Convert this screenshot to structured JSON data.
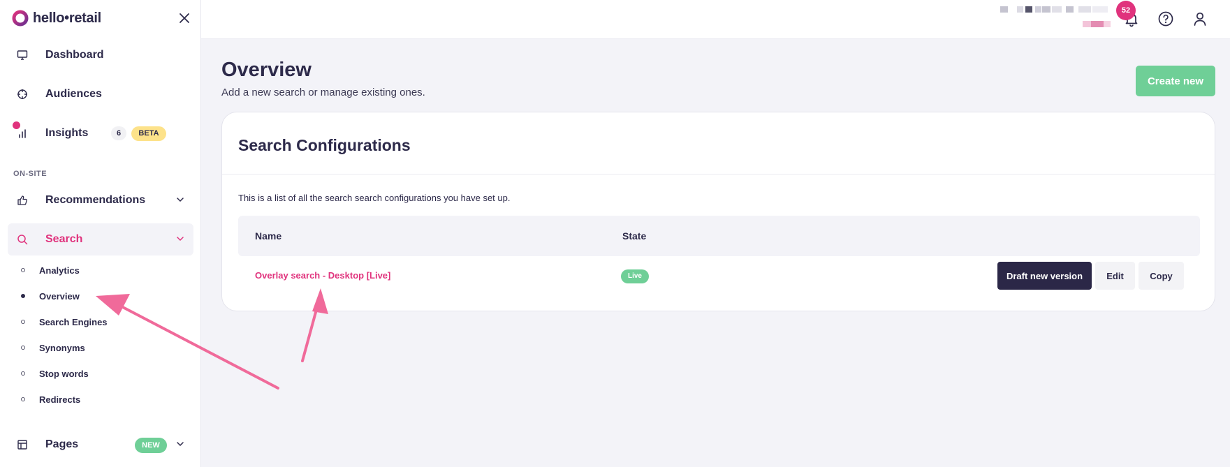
{
  "brand": {
    "name": "hello•retail",
    "pink": "#e0337d",
    "navy": "#2d2a4a",
    "green": "#6fcf97",
    "yellow": "#fde28a"
  },
  "sidebar": {
    "items": [
      {
        "label": "Dashboard",
        "icon": "monitor-icon"
      },
      {
        "label": "Audiences",
        "icon": "crosshair-icon"
      },
      {
        "label": "Insights",
        "icon": "bar-chart-icon",
        "count": "6",
        "badge": "BETA"
      }
    ],
    "section_label": "ON-SITE",
    "recommendations": {
      "label": "Recommendations",
      "icon": "thumbs-up-icon"
    },
    "search": {
      "label": "Search",
      "icon": "search-icon",
      "sub_items": [
        {
          "label": "Analytics",
          "active": false
        },
        {
          "label": "Overview",
          "active": true
        },
        {
          "label": "Search Engines",
          "active": false
        },
        {
          "label": "Synonyms",
          "active": false
        },
        {
          "label": "Stop words",
          "active": false
        },
        {
          "label": "Redirects",
          "active": false
        }
      ]
    },
    "pages": {
      "label": "Pages",
      "icon": "layout-icon",
      "badge": "NEW"
    }
  },
  "topbar": {
    "notification_count": "52"
  },
  "main": {
    "title": "Overview",
    "subtitle": "Add a new search or manage existing ones.",
    "create_label": "Create new",
    "card": {
      "title": "Search Configurations",
      "description": "This is a list of all the search search configurations you have set up.",
      "columns": [
        "Name",
        "State"
      ],
      "rows": [
        {
          "name": "Overlay search - Desktop [Live]",
          "state": "Live",
          "actions": [
            "Draft new version",
            "Edit",
            "Copy"
          ]
        }
      ]
    }
  }
}
